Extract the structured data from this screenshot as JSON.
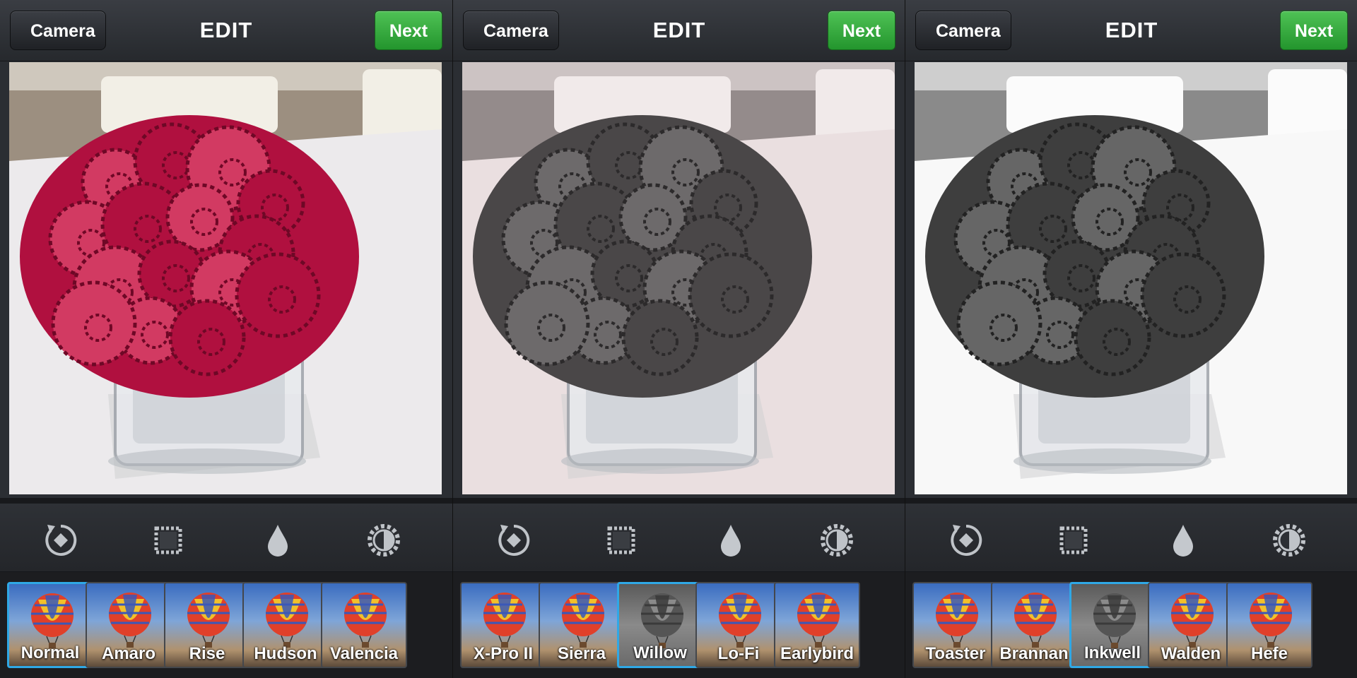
{
  "colors": {
    "accent_green": "#2fa23a",
    "selected_border": "#2fa8e6",
    "flower_red": "#b0103f"
  },
  "panels": [
    {
      "back_label": "Camera",
      "title": "EDIT",
      "next_label": "Next",
      "filter_style": "normal",
      "tools": [
        "rotate-icon",
        "border-frame-icon",
        "tilt-shift-drop-icon",
        "lux-brightness-icon"
      ],
      "filters": [
        {
          "label": "Normal",
          "selected": true
        },
        {
          "label": "Amaro",
          "selected": false
        },
        {
          "label": "Rise",
          "selected": false
        },
        {
          "label": "Hudson",
          "selected": false
        },
        {
          "label": "Valencia",
          "selected": false
        }
      ]
    },
    {
      "back_label": "Camera",
      "title": "EDIT",
      "next_label": "Next",
      "filter_style": "willow",
      "tools": [
        "rotate-icon",
        "border-frame-icon",
        "tilt-shift-drop-icon",
        "lux-brightness-icon"
      ],
      "filters": [
        {
          "label": "X-Pro II",
          "selected": false
        },
        {
          "label": "Sierra",
          "selected": false
        },
        {
          "label": "Willow",
          "selected": true
        },
        {
          "label": "Lo-Fi",
          "selected": false
        },
        {
          "label": "Earlybird",
          "selected": false
        }
      ]
    },
    {
      "back_label": "Camera",
      "title": "EDIT",
      "next_label": "Next",
      "filter_style": "inkwell",
      "tools": [
        "rotate-icon",
        "border-frame-icon",
        "tilt-shift-drop-icon",
        "lux-brightness-icon"
      ],
      "filters": [
        {
          "label": "Toaster",
          "selected": false
        },
        {
          "label": "Brannan",
          "selected": false
        },
        {
          "label": "Inkwell",
          "selected": true
        },
        {
          "label": "Walden",
          "selected": false
        },
        {
          "label": "Hefe",
          "selected": false
        }
      ]
    }
  ]
}
